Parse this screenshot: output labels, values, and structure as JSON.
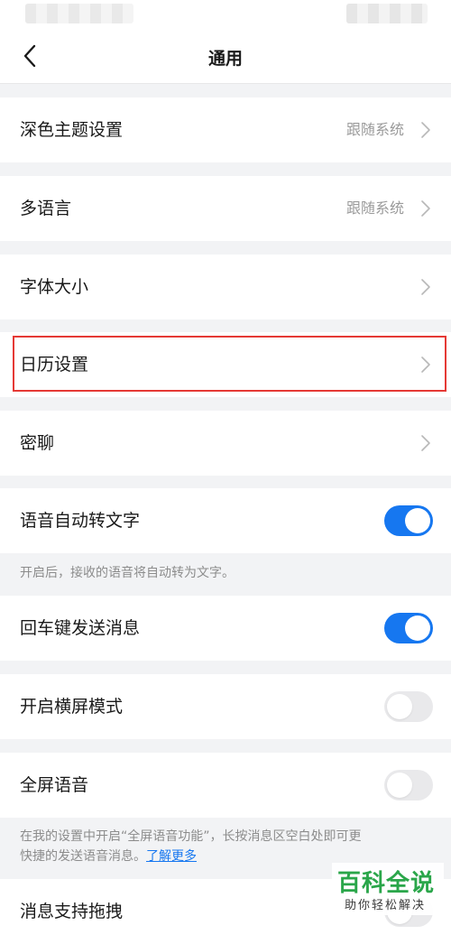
{
  "header": {
    "title": "通用"
  },
  "rows": [
    {
      "label": "深色主题设置",
      "value": "跟随系统"
    },
    {
      "label": "多语言",
      "value": "跟随系统"
    },
    {
      "label": "字体大小"
    },
    {
      "label": "日历设置"
    },
    {
      "label": "密聊"
    },
    {
      "label": "语音自动转文字",
      "toggle": true
    },
    {
      "label": "回车键发送消息",
      "toggle": true
    },
    {
      "label": "开启横屏模式",
      "toggle": false
    },
    {
      "label": "全屏语音",
      "toggle": false
    },
    {
      "label": "消息支持拖拽"
    }
  ],
  "hints": {
    "voice_to_text": "开启后，接收的语音将自动转为文字。",
    "fullscreen_voice_line1": "在我的设置中开启“全屏语音功能”，长按消息区空白处即可更",
    "fullscreen_voice_line2": "快捷的发送语音消息。",
    "learn_more": "了解更多"
  },
  "watermark": {
    "title": "百科全说",
    "subtitle": "助你轻松解决"
  },
  "colors": {
    "accent": "#1677f0",
    "highlight": "#e53935",
    "watermark": "#2aa64a"
  },
  "icons": {
    "back": "chevron-left-icon",
    "row_arrow": "chevron-right-icon"
  }
}
